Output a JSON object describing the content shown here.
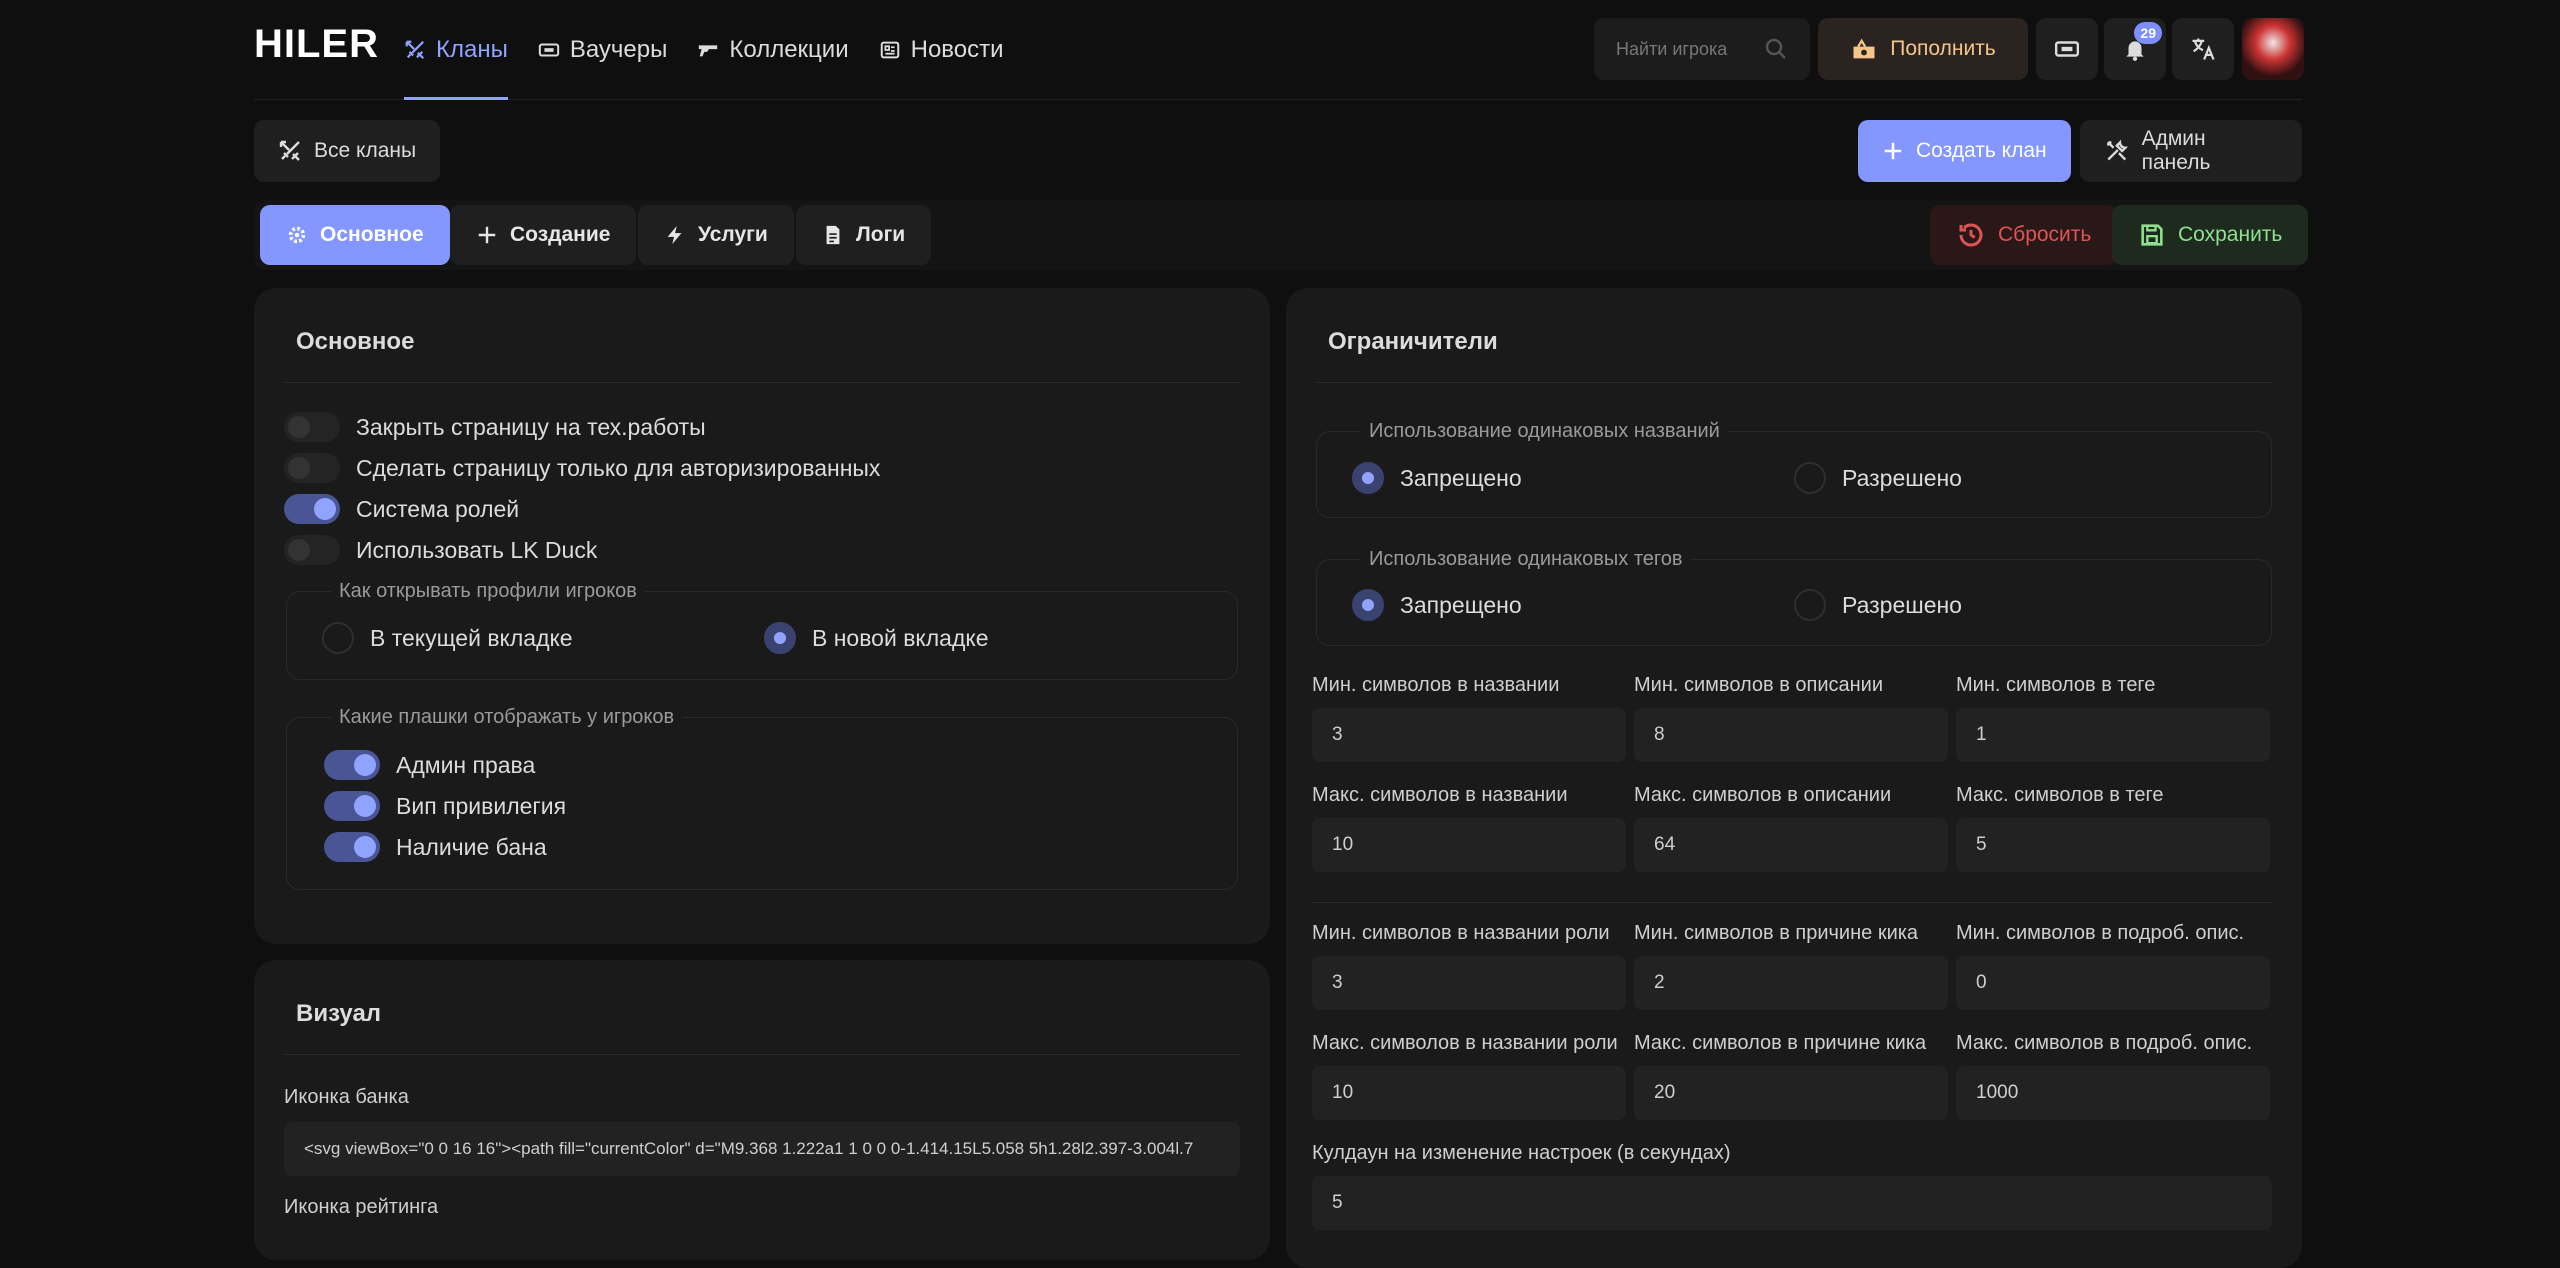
{
  "header": {
    "logo": "HILER",
    "search_placeholder": "Найти игрока",
    "topup": "Пополнить",
    "notifications_count": "29"
  },
  "nav": {
    "clans": "Кланы",
    "vouchers": "Ваучеры",
    "collections": "Коллекции",
    "news": "Новости"
  },
  "toolbar": {
    "all_clans": "Все кланы",
    "create_clan": "Создать клан",
    "admin_panel": "Админ панель"
  },
  "tabs": {
    "main": "Основное",
    "create": "Создание",
    "services": "Услуги",
    "logs": "Логи",
    "reset": "Сбросить",
    "save": "Сохранить"
  },
  "main_card": {
    "title": "Основное",
    "toggles": [
      {
        "label": "Закрыть страницу на тех.работы",
        "on": false
      },
      {
        "label": "Сделать страницу только для авторизированных",
        "on": false
      },
      {
        "label": "Система ролей",
        "on": true
      },
      {
        "label": "Использовать LK Duck",
        "on": false
      }
    ],
    "profiles_legend": "Как открывать профили игроков",
    "profiles_opt1": "В текущей вкладке",
    "profiles_opt2": "В новой вкладке",
    "badges_legend": "Какие плашки отображать у игроков",
    "badges": [
      {
        "label": "Админ права",
        "on": true
      },
      {
        "label": "Вип привилегия",
        "on": true
      },
      {
        "label": "Наличие бана",
        "on": true
      }
    ]
  },
  "visual_card": {
    "title": "Визуал",
    "bank_icon_label": "Иконка банка",
    "bank_icon_value": "<svg viewBox=\"0 0 16 16\"><path fill=\"currentColor\" d=\"M9.368 1.222a1 1 0 0 0-1.414.15L5.058 5h1.28l2.397-3.004l.7",
    "rating_icon_label": "Иконка рейтинга"
  },
  "limits_card": {
    "title": "Ограничители",
    "same_names_legend": "Использование одинаковых названий",
    "same_tags_legend": "Использование одинаковых тегов",
    "forbidden": "Запрещено",
    "allowed": "Разрешено",
    "fields": [
      {
        "label": "Мин. символов в названии",
        "value": "3"
      },
      {
        "label": "Мин. символов в описании",
        "value": "8"
      },
      {
        "label": "Мин. символов в теге",
        "value": "1"
      },
      {
        "label": "Макс. символов в названии",
        "value": "10"
      },
      {
        "label": "Макс. символов в описании",
        "value": "64"
      },
      {
        "label": "Макс. символов в теге",
        "value": "5"
      },
      {
        "label": "Мин. символов в названии роли",
        "value": "3"
      },
      {
        "label": "Мин. символов в причине кика",
        "value": "2"
      },
      {
        "label": "Мин. символов в подроб. опис.",
        "value": "0"
      },
      {
        "label": "Макс. символов в названии роли",
        "value": "10"
      },
      {
        "label": "Макс. символов в причине кика",
        "value": "20"
      },
      {
        "label": "Макс. символов в подроб. опис.",
        "value": "1000"
      }
    ],
    "cooldown_label": "Кулдаун на изменение настроек (в секундах)",
    "cooldown_value": "5"
  }
}
